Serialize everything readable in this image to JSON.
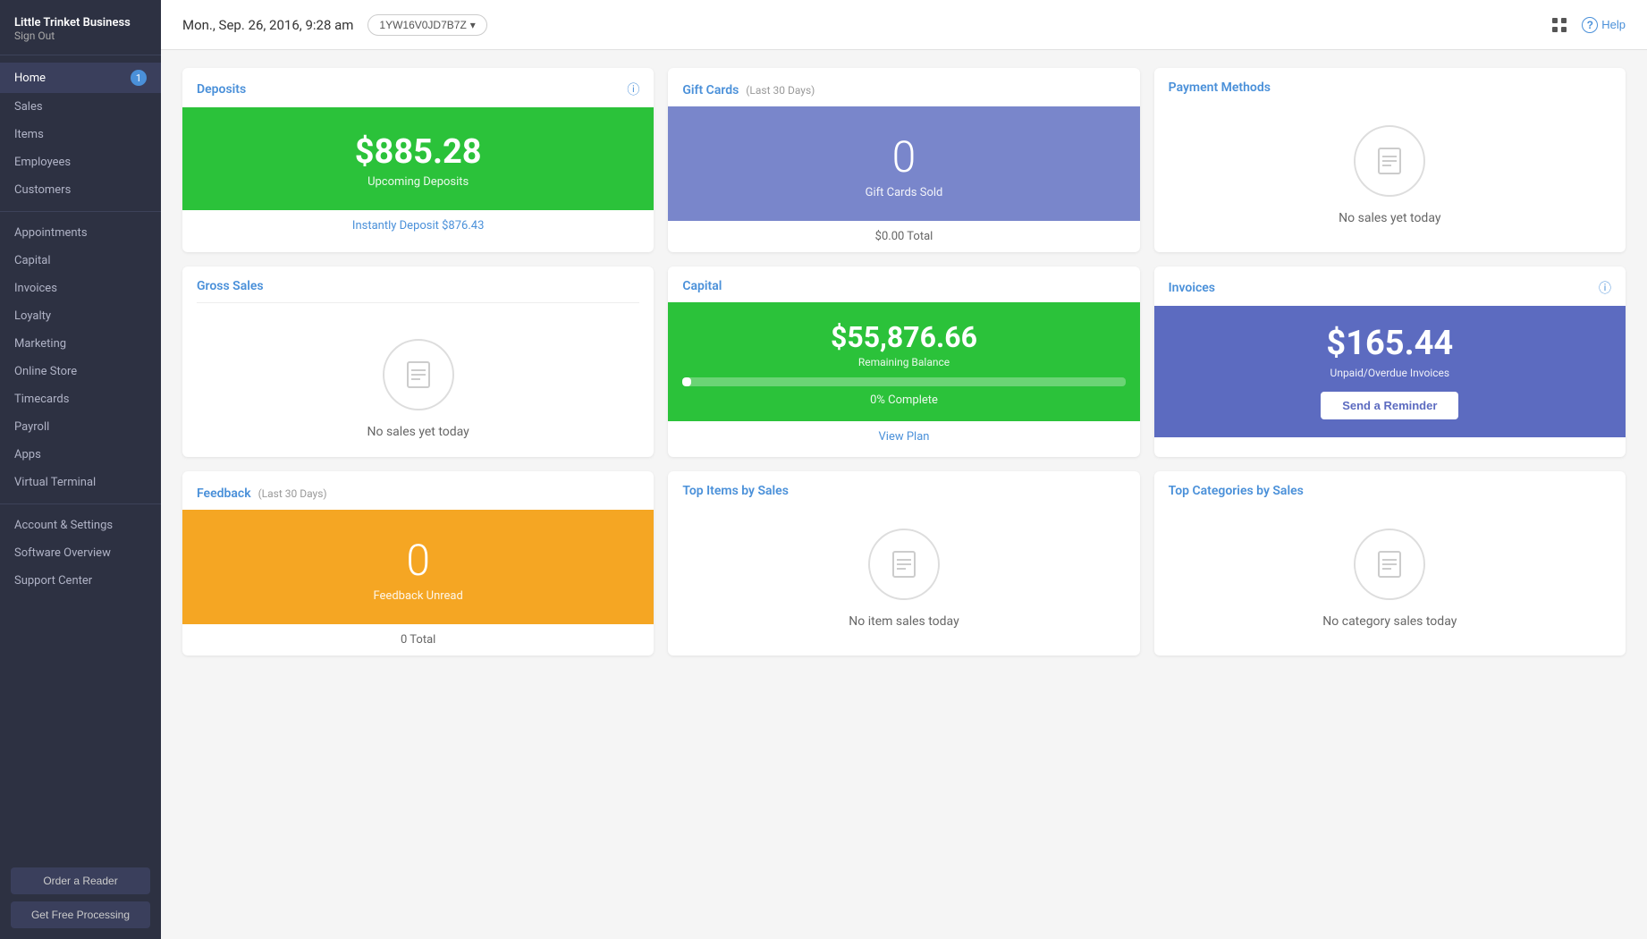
{
  "sidebar": {
    "brand": "Little Trinket Business",
    "sign_out": "Sign Out",
    "nav_items": [
      {
        "label": "Home",
        "badge": "1",
        "active": true
      },
      {
        "label": "Sales",
        "badge": null,
        "active": false
      },
      {
        "label": "Items",
        "badge": null,
        "active": false
      },
      {
        "label": "Employees",
        "badge": null,
        "active": false
      },
      {
        "label": "Customers",
        "badge": null,
        "active": false
      }
    ],
    "more_items": [
      {
        "label": "Appointments"
      },
      {
        "label": "Capital"
      },
      {
        "label": "Invoices"
      },
      {
        "label": "Loyalty"
      },
      {
        "label": "Marketing"
      },
      {
        "label": "Online Store"
      },
      {
        "label": "Timecards"
      },
      {
        "label": "Payroll"
      },
      {
        "label": "Apps"
      },
      {
        "label": "Virtual Terminal"
      }
    ],
    "bottom_items": [
      {
        "label": "Account & Settings"
      },
      {
        "label": "Software Overview"
      },
      {
        "label": "Support Center"
      }
    ],
    "buttons": [
      {
        "label": "Order a Reader"
      },
      {
        "label": "Get Free Processing"
      }
    ]
  },
  "topbar": {
    "datetime": "Mon., Sep. 26, 2016, 9:28 am",
    "location_id": "1YW16V0JD7B7Z",
    "help_label": "Help"
  },
  "deposits_card": {
    "title": "Deposits",
    "amount": "$885.28",
    "label": "Upcoming Deposits",
    "link": "Instantly Deposit $876.43"
  },
  "gift_cards_card": {
    "title": "Gift Cards",
    "subtitle": "(Last 30 Days)",
    "number": "0",
    "label": "Gift Cards Sold",
    "footer": "$0.00 Total"
  },
  "payment_methods_card": {
    "title": "Payment Methods",
    "no_sales": "No sales yet today"
  },
  "gross_sales_card": {
    "title": "Gross Sales",
    "no_sales": "No sales yet today"
  },
  "capital_card": {
    "title": "Capital",
    "amount": "$55,876.66",
    "label": "Remaining Balance",
    "percent": "0%",
    "complete": "Complete",
    "link": "View Plan",
    "progress_width": "2"
  },
  "invoices_card": {
    "title": "Invoices",
    "amount": "$165.44",
    "label": "Unpaid/Overdue Invoices",
    "button": "Send a Reminder"
  },
  "feedback_card": {
    "title": "Feedback",
    "subtitle": "(Last 30 Days)",
    "number": "0",
    "label": "Feedback Unread",
    "footer": "0 Total"
  },
  "top_items_card": {
    "title": "Top Items by Sales",
    "no_sales": "No item sales today"
  },
  "top_categories_card": {
    "title": "Top Categories by Sales",
    "no_sales": "No category sales today"
  },
  "icons": {
    "receipt": "🧾",
    "info": "ⓘ",
    "chevron_down": "▾",
    "grid": "⊞"
  }
}
